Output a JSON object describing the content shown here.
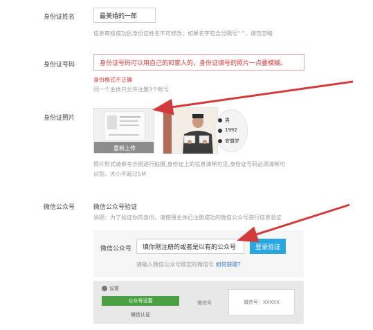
{
  "name": {
    "label": "身份证姓名",
    "value": "最美婚的一郎",
    "hint": "信息审核成功后身份证姓名不可修改；如果名字包含分隔号“·”，请勿忽略"
  },
  "id_number": {
    "label": "身份证号码",
    "value": "身份证号码可以用自己的和家人的，身份证填号的照片一点要模糊。",
    "error": "身份格式不正确",
    "hint": "同一个主体只允许注册3个帐号"
  },
  "photo": {
    "label": "身份证照片",
    "upload_label": "重新上传",
    "sample_fields": [
      "男",
      "1992",
      "安徽岁"
    ],
    "hint_line1": "照片形式请参考示例进行拍摄,身份证上的信息清晰可见,身份证号码必须清晰可",
    "hint_line2": "识别，大小不超过5M"
  },
  "wechat": {
    "label": "微信公众号",
    "title": "微信公众号验证",
    "desc": "说明：为了验证你的身份，请使用主体已注册成功的微信公众号进行信息验证",
    "field_label": "微信公众号",
    "field_value": "填你刚注册的或者是以有的公众号",
    "verify_button": "登录验证",
    "bind_hint": "请输入微信公众号绑定的微信号",
    "bind_link": "如何获取？"
  },
  "preview": {
    "settings": "设置",
    "menu_active": "公众号设置",
    "menu_item": "微信认证",
    "field_label": "微信号",
    "popup_text": "微信号：XXXXX"
  },
  "colors": {
    "error": "#d93a3a",
    "link": "#2a7ad4",
    "button": "#2aa6df",
    "green": "#49a144",
    "arrow": "#d23b3b"
  }
}
